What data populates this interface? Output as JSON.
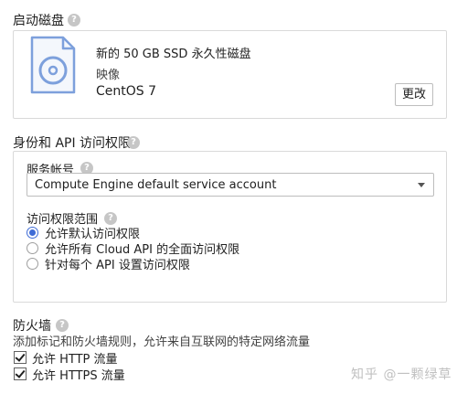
{
  "boot_disk": {
    "title": "启动磁盘",
    "disk_title": "新的 50 GB SSD 永久性磁盘",
    "image_label": "映像",
    "image_name": "CentOS 7",
    "change_button": "更改"
  },
  "identity": {
    "title": "身份和 API 访问权限",
    "service_account_label": "服务帐号",
    "service_account_value": "Compute Engine default service account",
    "access_scope_label": "访问权限范围",
    "options": [
      {
        "label": "允许默认访问权限",
        "checked": true
      },
      {
        "label": "允许所有 Cloud API 的全面访问权限",
        "checked": false
      },
      {
        "label": "针对每个 API 设置访问权限",
        "checked": false
      }
    ]
  },
  "firewall": {
    "title": "防火墙",
    "description": "添加标记和防火墙规则，允许来自互联网的特定网络流量",
    "checkboxes": [
      {
        "label": "允许 HTTP 流量",
        "checked": true
      },
      {
        "label": "允许 HTTPS 流量",
        "checked": true
      }
    ]
  },
  "help_glyph": "?",
  "watermark": "知乎 @一颗绿草",
  "colors": {
    "accent": "#3f6cd6",
    "disk_icon": "#7da0dc",
    "help_icon": "#c6c6c6"
  }
}
